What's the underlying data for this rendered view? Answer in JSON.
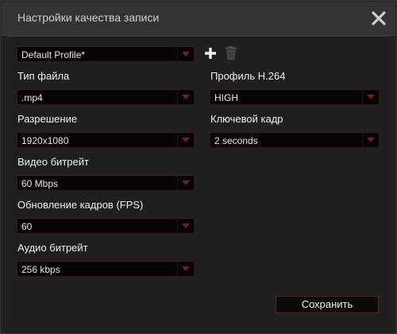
{
  "window": {
    "title": "Настройки качества записи"
  },
  "profile": {
    "selected": "Default Profile*"
  },
  "file_type": {
    "label": "Тип файла",
    "selected": ".mp4"
  },
  "resolution": {
    "label": "Разрешение",
    "selected": "1920x1080"
  },
  "video_bitrate": {
    "label": "Видео битрейт",
    "selected": "60 Mbps"
  },
  "fps": {
    "label": "Обновление кадров (FPS)",
    "selected": "60"
  },
  "audio_bitrate": {
    "label": "Аудио битрейт",
    "selected": "256 kbps"
  },
  "h264_profile": {
    "label": "Профиль H.264",
    "selected": "HIGH"
  },
  "keyframe": {
    "label": "Ключевой кадр",
    "selected": "2 seconds"
  },
  "actions": {
    "save_label": "Сохранить"
  },
  "colors": {
    "accent_arrow": "#7a1c1c",
    "select_bg": "#050505",
    "window_bg": "#212121"
  },
  "icons": {
    "close": "close-icon",
    "add": "plus-icon",
    "delete": "trash-icon",
    "dropdown": "chevron-down-icon"
  }
}
